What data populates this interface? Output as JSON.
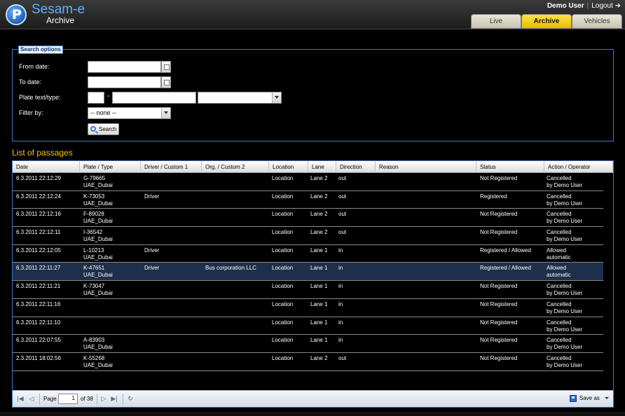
{
  "header": {
    "brand": "Sesam-e",
    "subtitle": "Archive",
    "logo_letter": "P",
    "user": "Demo User",
    "separator": "|",
    "logout": "Logout",
    "tabs": [
      "Live",
      "Archive",
      "Vehicles"
    ]
  },
  "search": {
    "legend": "Search options",
    "from_label": "From date:",
    "to_label": "To date:",
    "plate_label": "Plate text/type:",
    "filter_label": "Filter by:",
    "from_value": "",
    "to_value": "",
    "plate_prefix": "",
    "plate_dash": "-",
    "plate_text": "",
    "plate_type": "",
    "filter_value": "-- none --",
    "button": "Search"
  },
  "list": {
    "title": "List of passages",
    "columns": [
      "Date",
      "Plate / Type",
      "Driver / Custom 1",
      "Org. / Custom 2",
      "Location",
      "Lane",
      "Direction",
      "Reason",
      "Status",
      "Action / Operator"
    ],
    "rows": [
      {
        "date": "6.3.2011 22:12:29",
        "plate": "G-79665",
        "ptype": "UAE_Dubai",
        "driver": "",
        "org": "",
        "location": "Location",
        "lane": "Lane 2",
        "direction": "out",
        "reason": "",
        "status": "Not Registered",
        "action": "Cancelled",
        "operator": "by Demo User"
      },
      {
        "date": "6.3.2011 22:12:24",
        "plate": "K-73053",
        "ptype": "UAE_Dubai",
        "driver": "Driver",
        "org": "",
        "location": "Location",
        "lane": "Lane 2",
        "direction": "out",
        "reason": "",
        "status": "Registered",
        "action": "Cancelled",
        "operator": "by Demo User"
      },
      {
        "date": "6.3.2011 22:12:16",
        "plate": "F-89028",
        "ptype": "UAE_Dubai",
        "driver": "",
        "org": "",
        "location": "Location",
        "lane": "Lane 2",
        "direction": "out",
        "reason": "",
        "status": "Not Registered",
        "action": "Cancelled",
        "operator": "by Demo User"
      },
      {
        "date": "6.3.2011 22:12:11",
        "plate": "I-36542",
        "ptype": "UAE_Dubai",
        "driver": "",
        "org": "",
        "location": "Location",
        "lane": "Lane 2",
        "direction": "out",
        "reason": "",
        "status": "Not Registered",
        "action": "Cancelled",
        "operator": "by Demo User"
      },
      {
        "date": "6.3.2011 22:12:05",
        "plate": "L-10213",
        "ptype": "UAE_Dubai",
        "driver": "Driver",
        "org": "",
        "location": "Location",
        "lane": "Lane 1",
        "direction": "in",
        "reason": "",
        "status": "Registered / Allowed",
        "action": "Allowed",
        "operator": "automatic"
      },
      {
        "date": "6.3.2011 22:11:27",
        "plate": "K-47651",
        "ptype": "UAE_Dubai",
        "driver": "Driver",
        "org": "Bus corporation LLC",
        "location": "Location",
        "lane": "Lane 1",
        "direction": "in",
        "reason": "",
        "status": "Registered / Allowed",
        "action": "Allowed",
        "operator": "automatic"
      },
      {
        "date": "6.3.2011 22:11:21",
        "plate": "K-73047",
        "ptype": "UAE_Dubai",
        "driver": "",
        "org": "",
        "location": "Location",
        "lane": "Lane 1",
        "direction": "in",
        "reason": "",
        "status": "Not Registered",
        "action": "Cancelled",
        "operator": "by Demo User"
      },
      {
        "date": "6.3.2011 22:11:16",
        "plate": "",
        "ptype": "",
        "driver": "",
        "org": "",
        "location": "Location",
        "lane": "Lane 1",
        "direction": "in",
        "reason": "",
        "status": "Not Registered",
        "action": "Cancelled",
        "operator": "by Demo User"
      },
      {
        "date": "6.3.2011 22:11:10",
        "plate": "",
        "ptype": "",
        "driver": "",
        "org": "",
        "location": "Location",
        "lane": "Lane 1",
        "direction": "in",
        "reason": "",
        "status": "Not Registered",
        "action": "Cancelled",
        "operator": "by Demo User"
      },
      {
        "date": "6.3.2011 22:07:55",
        "plate": "A-83903",
        "ptype": "UAE_Dubai",
        "driver": "",
        "org": "",
        "location": "Location",
        "lane": "Lane 1",
        "direction": "in",
        "reason": "",
        "status": "Not Registered",
        "action": "Cancelled",
        "operator": "by Demo User"
      },
      {
        "date": "2.3.2011 18:02:56",
        "plate": "K-55268",
        "ptype": "UAE_Dubai",
        "driver": "",
        "org": "",
        "location": "Location",
        "lane": "Lane 2",
        "direction": "out",
        "reason": "",
        "status": "Not Registered",
        "action": "Cancelled",
        "operator": "by Demo User"
      }
    ],
    "selected_row": 5
  },
  "pager": {
    "page_label": "Page",
    "page_value": "1",
    "of_text": "of 38",
    "save_as": "Save as",
    "icons": [
      "first-page-icon",
      "prev-page-icon",
      "next-page-icon",
      "last-page-icon",
      "refresh-icon",
      "save-icon"
    ]
  },
  "colors": {
    "accent": "#f5c400",
    "border": "#3e78c8",
    "brand": "#5fb0ff",
    "selected_row": "#1d2f4a"
  }
}
